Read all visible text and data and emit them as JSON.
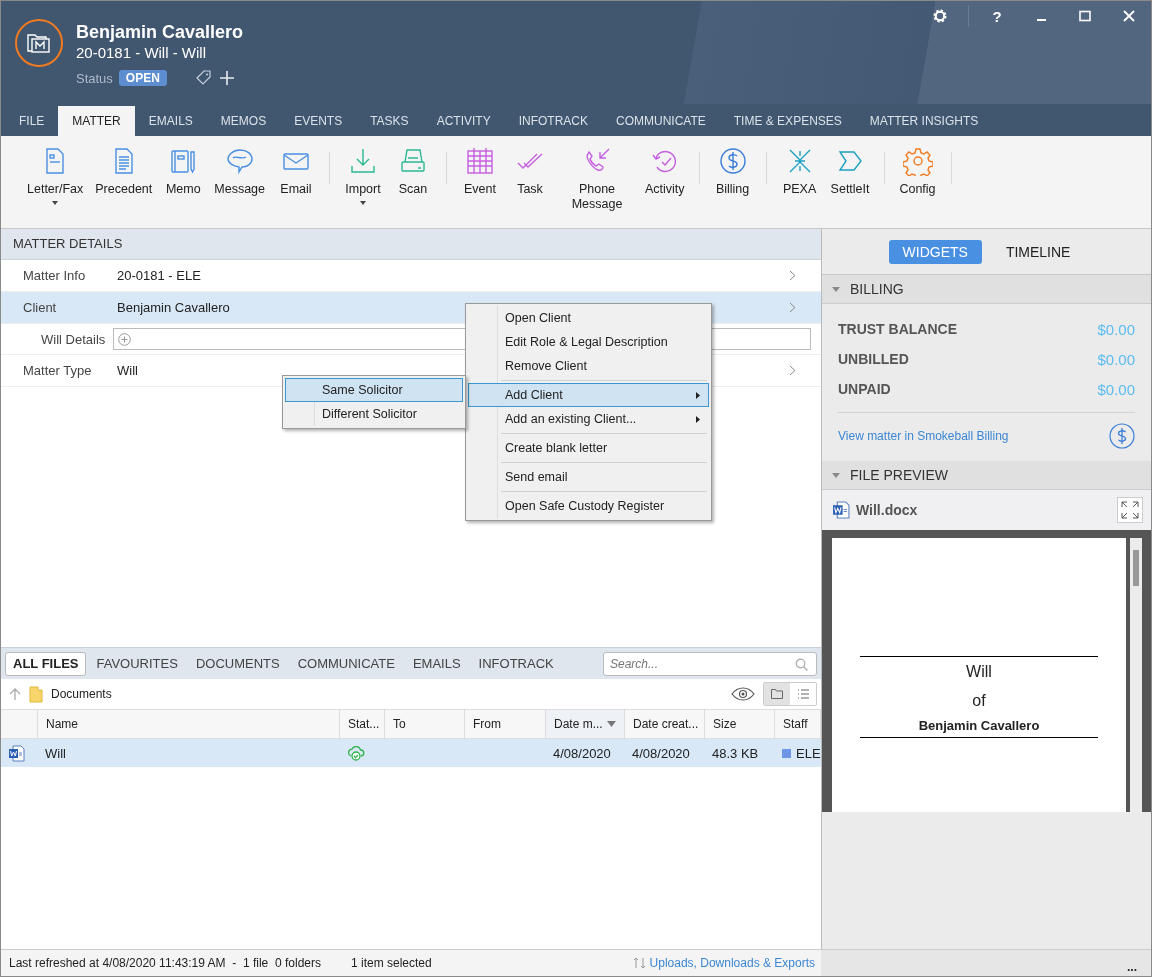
{
  "header": {
    "client": "Benjamin Cavallero",
    "matter": "20-0181 - Will - Will",
    "status_label": "Status",
    "status": "OPEN",
    "help": "?"
  },
  "tabs": [
    {
      "label": "FILE",
      "selected": false
    },
    {
      "label": "MATTER",
      "selected": true
    },
    {
      "label": "EMAILS",
      "selected": false
    },
    {
      "label": "MEMOS",
      "selected": false
    },
    {
      "label": "EVENTS",
      "selected": false
    },
    {
      "label": "TASKS",
      "selected": false
    },
    {
      "label": "ACTIVITY",
      "selected": false
    },
    {
      "label": "INFOTRACK",
      "selected": false
    },
    {
      "label": "COMMUNICATE",
      "selected": false
    },
    {
      "label": "TIME & EXPENSES",
      "selected": false
    },
    {
      "label": "MATTER INSIGHTS",
      "selected": false
    }
  ],
  "ribbon": [
    [
      {
        "label": "Letter/Fax",
        "dropdown": true
      },
      {
        "label": "Precedent",
        "dropdown": false
      },
      {
        "label": "Memo",
        "dropdown": false
      },
      {
        "label": "Message",
        "dropdown": false
      },
      {
        "label": "Email",
        "dropdown": false
      }
    ],
    [
      {
        "label": "Import",
        "dropdown": true
      },
      {
        "label": "Scan",
        "dropdown": false
      }
    ],
    [
      {
        "label": "Event",
        "dropdown": false
      },
      {
        "label": "Task",
        "dropdown": false
      },
      {
        "label": "Phone Message",
        "dropdown": false
      },
      {
        "label": "Activity",
        "dropdown": false
      }
    ],
    [
      {
        "label": "Billing",
        "dropdown": false
      }
    ],
    [
      {
        "label": "PEXA",
        "dropdown": false
      },
      {
        "label": "SettleIt",
        "dropdown": false
      }
    ],
    [
      {
        "label": "Config",
        "dropdown": false
      }
    ]
  ],
  "matter_details": {
    "title": "MATTER DETAILS",
    "rows": [
      {
        "kind": "link",
        "label": "Matter Info",
        "value": "20-0181 - ELE",
        "selected": false
      },
      {
        "kind": "link",
        "label": "Client",
        "value": "Benjamin Cavallero",
        "selected": true
      },
      {
        "kind": "field",
        "label": "Will Details"
      },
      {
        "kind": "link",
        "label": "Matter Type",
        "value": "Will",
        "selected": false
      }
    ]
  },
  "context_menu": {
    "groups": [
      [
        {
          "label": "Open Client",
          "submenu": false,
          "selected": false
        },
        {
          "label": "Edit Role & Legal Description",
          "submenu": false,
          "selected": false
        },
        {
          "label": "Remove Client",
          "submenu": false,
          "selected": false
        }
      ],
      [
        {
          "label": "Add Client",
          "submenu": true,
          "selected": true
        },
        {
          "label": "Add an existing Client...",
          "submenu": true,
          "selected": false
        }
      ],
      [
        {
          "label": "Create blank letter",
          "submenu": false,
          "selected": false
        }
      ],
      [
        {
          "label": "Send email",
          "submenu": false,
          "selected": false
        }
      ],
      [
        {
          "label": "Open Safe Custody Register",
          "submenu": false,
          "selected": false
        }
      ]
    ]
  },
  "submenu": {
    "items": [
      {
        "label": "Same Solicitor",
        "selected": true
      },
      {
        "label": "Different Solicitor",
        "selected": false
      }
    ]
  },
  "files": {
    "tabs": [
      {
        "label": "ALL FILES",
        "selected": true
      },
      {
        "label": "FAVOURITES",
        "selected": false
      },
      {
        "label": "DOCUMENTS",
        "selected": false
      },
      {
        "label": "COMMUNICATE",
        "selected": false
      },
      {
        "label": "EMAILS",
        "selected": false
      },
      {
        "label": "INFOTRACK",
        "selected": false
      }
    ],
    "search": {
      "placeholder": "Search..."
    },
    "folder": "Documents",
    "columns": [
      {
        "label": "Name",
        "sorted": false
      },
      {
        "label": "Stat...",
        "sorted": false
      },
      {
        "label": "To",
        "sorted": false
      },
      {
        "label": "From",
        "sorted": false
      },
      {
        "label": "Date m...",
        "sorted": true
      },
      {
        "label": "Date creat...",
        "sorted": false
      },
      {
        "label": "Size",
        "sorted": false
      },
      {
        "label": "Staff",
        "sorted": false
      }
    ],
    "rows": [
      {
        "name": "Will",
        "date_modified": "4/08/2020",
        "date_created": "4/08/2020",
        "size": "48.3 KB",
        "staff": "ELE",
        "color": "#6f96e6",
        "selected": true
      }
    ]
  },
  "right_panel": {
    "tabs": [
      {
        "label": "WIDGETS",
        "selected": true
      },
      {
        "label": "TIMELINE",
        "selected": false
      }
    ],
    "billing": {
      "title": "BILLING",
      "expanded": true,
      "rows": [
        {
          "label": "TRUST BALANCE",
          "value": "$0.00"
        },
        {
          "label": "UNBILLED",
          "value": "$0.00"
        },
        {
          "label": "UNPAID",
          "value": "$0.00"
        }
      ],
      "link": "View matter in Smokeball Billing"
    },
    "preview": {
      "title": "FILE PREVIEW",
      "expanded": true,
      "file": "Will.docx",
      "document": {
        "title": "Will",
        "of": "of",
        "name": "Benjamin Cavallero"
      }
    }
  },
  "status_bar": {
    "refreshed": "Last refreshed at 4/08/2020 11:43:19 AM  -  1 file  0 folders",
    "selection": "1 item selected",
    "link": "Uploads, Downloads & Exports",
    "more": "..."
  }
}
